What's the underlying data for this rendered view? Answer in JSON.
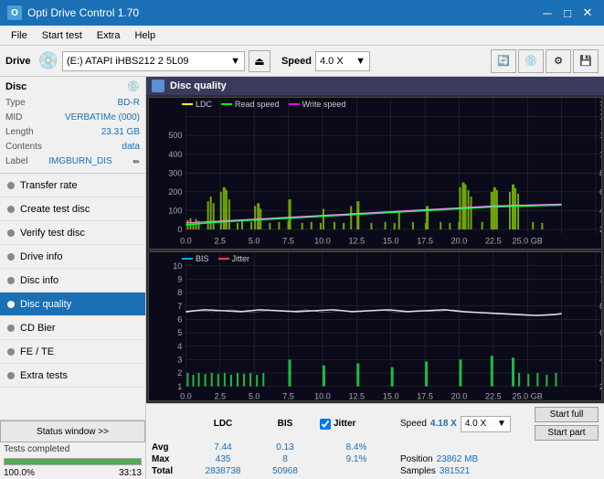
{
  "titleBar": {
    "title": "Opti Drive Control 1.70",
    "iconLabel": "O",
    "minBtn": "─",
    "maxBtn": "□",
    "closeBtn": "✕"
  },
  "menuBar": {
    "items": [
      "File",
      "Start test",
      "Extra",
      "Help"
    ]
  },
  "toolbar": {
    "driveLabel": "Drive",
    "driveValue": "(E:)  ATAPI iHBS212  2 5L09",
    "speedLabel": "Speed",
    "speedValue": "4.0 X"
  },
  "discPanel": {
    "title": "Disc",
    "rows": [
      {
        "key": "Type",
        "value": "BD-R"
      },
      {
        "key": "MID",
        "value": "VERBATIMe (000)"
      },
      {
        "key": "Length",
        "value": "23.31 GB"
      },
      {
        "key": "Contents",
        "value": "data"
      },
      {
        "key": "Label",
        "value": "IMGBURN_DIS"
      }
    ]
  },
  "navItems": [
    {
      "id": "transfer-rate",
      "label": "Transfer rate",
      "active": false
    },
    {
      "id": "create-test-disc",
      "label": "Create test disc",
      "active": false
    },
    {
      "id": "verify-test-disc",
      "label": "Verify test disc",
      "active": false
    },
    {
      "id": "drive-info",
      "label": "Drive info",
      "active": false
    },
    {
      "id": "disc-info",
      "label": "Disc info",
      "active": false
    },
    {
      "id": "disc-quality",
      "label": "Disc quality",
      "active": true
    },
    {
      "id": "cd-bier",
      "label": "CD Bier",
      "active": false
    },
    {
      "id": "fe-te",
      "label": "FE / TE",
      "active": false
    },
    {
      "id": "extra-tests",
      "label": "Extra tests",
      "active": false
    }
  ],
  "statusBar": {
    "statusWindowBtn": "Status window >>",
    "statusText": "Tests completed",
    "progressPercent": 100,
    "progressText": "100.0%",
    "time": "33:13"
  },
  "chartTitle": "Disc quality",
  "legend1": {
    "ldc": "LDC",
    "readSpeed": "Read speed",
    "writeSpeed": "Write speed"
  },
  "legend2": {
    "bis": "BIS",
    "jitter": "Jitter"
  },
  "stats": {
    "columns": [
      "LDC",
      "BIS",
      "",
      "Jitter",
      "Speed",
      ""
    ],
    "avg": {
      "ldc": "7.44",
      "bis": "0.13",
      "jitter": "8.4%",
      "speedVal": "4.18 X",
      "speedDropdown": "4.0 X"
    },
    "max": {
      "ldc": "435",
      "bis": "8",
      "jitter": "9.1%",
      "posLabel": "Position",
      "posValue": "23862 MB"
    },
    "total": {
      "ldc": "2838738",
      "bis": "50968",
      "samplesLabel": "Samples",
      "samplesValue": "381521"
    },
    "startFull": "Start full",
    "startPart": "Start part"
  }
}
